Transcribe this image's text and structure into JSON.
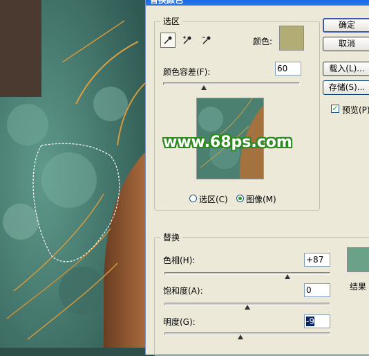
{
  "dialog": {
    "title": "替换颜色"
  },
  "selection": {
    "group_title": "选区",
    "color_label": "颜色:",
    "color_swatch": "#b1ad74",
    "tolerance_label": "颜色容差(F):",
    "tolerance_value": "60",
    "tolerance_fraction": 0.3,
    "preview_mode_selection": "选区(C)",
    "preview_mode_image": "图像(M)",
    "selected_mode": "image",
    "eyedropper_icons": [
      "eyedropper-icon",
      "eyedropper-add-icon",
      "eyedropper-subtract-icon"
    ]
  },
  "buttons": {
    "ok": "确定",
    "cancel": "取消",
    "load": "载入(L)...",
    "save": "存储(S)..."
  },
  "preview_checkbox": {
    "label": "预览(P)",
    "checked": true
  },
  "replace": {
    "group_title": "替换",
    "hue_label": "色相(H):",
    "hue_value": "+87",
    "hue_fraction": 0.74,
    "saturation_label": "饱和度(A):",
    "saturation_value": "0",
    "saturation_fraction": 0.5,
    "lightness_label": "明度(G):",
    "lightness_value": "-9",
    "lightness_fraction": 0.46,
    "result_label": "结果",
    "result_swatch": "#6aa187"
  },
  "watermark": "www.68ps.com"
}
